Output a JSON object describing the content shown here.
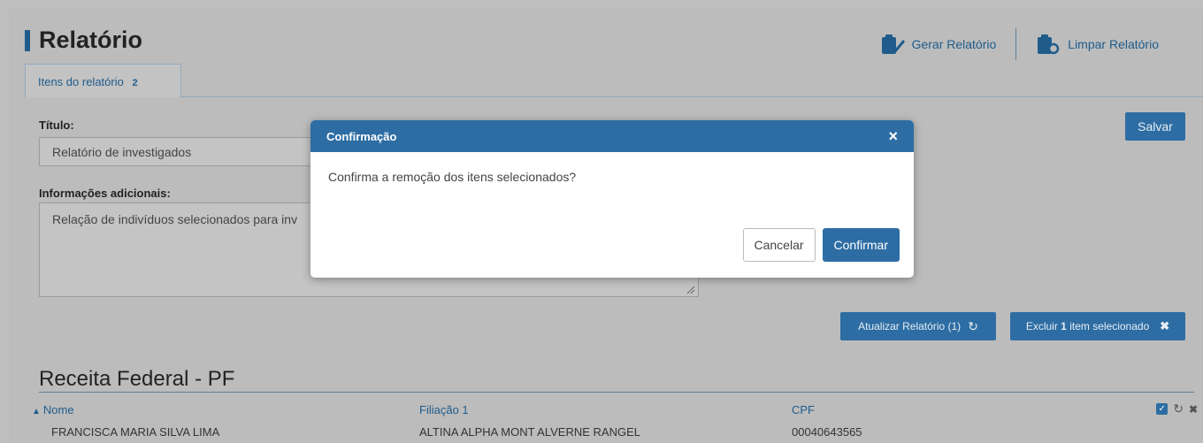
{
  "page": {
    "title": "Relatório",
    "toolbar": {
      "generate_label": "Gerar Relatório",
      "clear_label": "Limpar Relatório"
    },
    "tab": {
      "label": "Itens do relatório",
      "count": "2"
    }
  },
  "form": {
    "title_label": "Título:",
    "title_value": "Relatório de investigados",
    "info_label": "Informações adicionais:",
    "info_value": "Relação de indivíduos selecionados para inv",
    "save_label": "Salvar",
    "update_label": "Atualizar Relatório (1)",
    "delete_prefix": "Excluir ",
    "delete_count": "1",
    "delete_suffix": " item selecionado"
  },
  "section": {
    "title": "Receita Federal - PF",
    "columns": [
      "Nome",
      "Filiação 1",
      "CPF"
    ],
    "row": [
      "FRANCISCA MARIA SILVA LIMA",
      "ALTINA ALPHA MONT ALVERNE RANGEL",
      "00040643565"
    ]
  },
  "modal": {
    "title": "Confirmação",
    "message": "Confirma a remoção dos itens selecionados?",
    "cancel_label": "Cancelar",
    "confirm_label": "Confirmar"
  },
  "colors": {
    "primary": "#2d6da3",
    "overlay": "#bcbcbc"
  }
}
